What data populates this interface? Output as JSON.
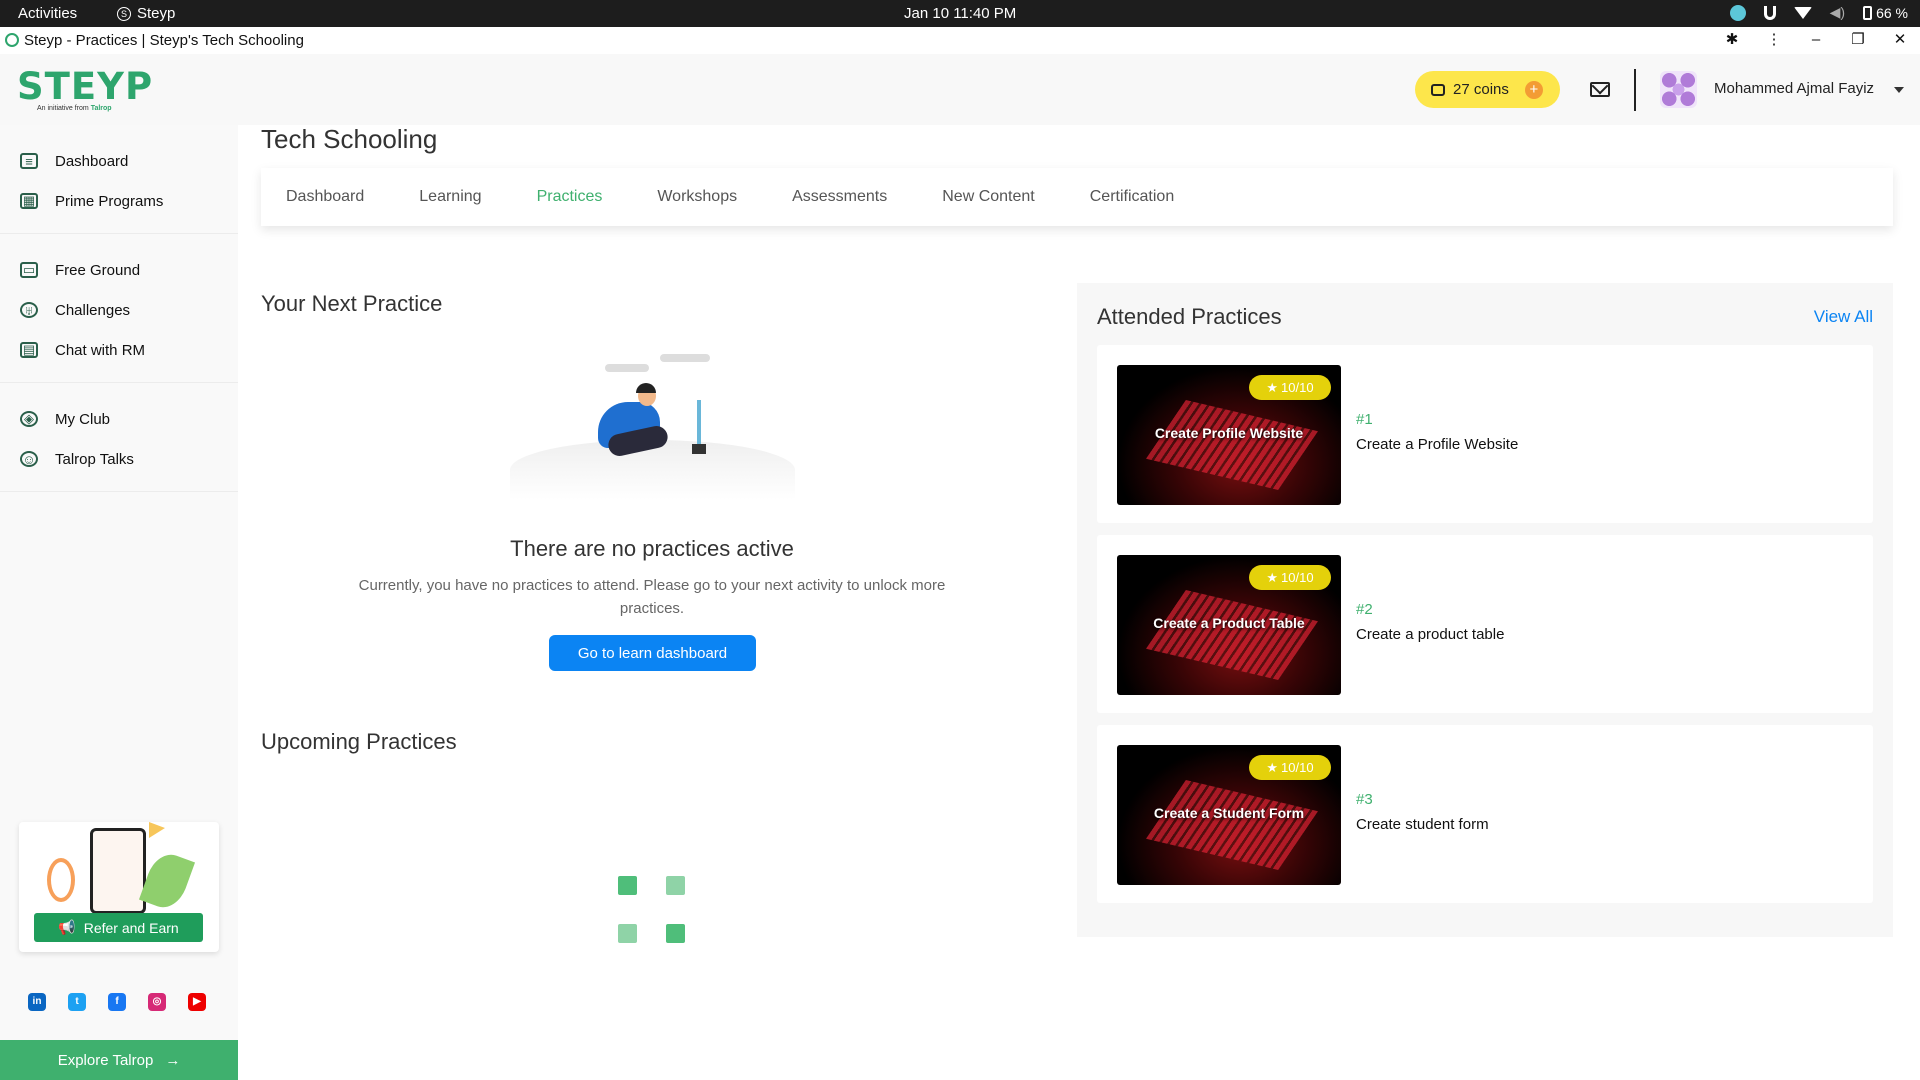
{
  "os": {
    "activities": "Activities",
    "app": "Steyp",
    "clock": "Jan 10  11:40 PM",
    "battery": "66 %"
  },
  "browser": {
    "title": "Steyp - Practices | Steyp's Tech Schooling"
  },
  "header": {
    "logo": "STEYP",
    "tagline_prefix": "An initiative from",
    "tagline_brand": "Talrop",
    "coins": "27 coins",
    "user_name": "Mohammed Ajmal Fayiz"
  },
  "sidebar": {
    "groups": [
      [
        {
          "label": "Dashboard",
          "icon": "dashboard-icon"
        },
        {
          "label": "Prime Programs",
          "icon": "calendar-icon"
        }
      ],
      [
        {
          "label": "Free Ground",
          "icon": "ground-icon"
        },
        {
          "label": "Challenges",
          "icon": "trophy-icon"
        },
        {
          "label": "Chat with RM",
          "icon": "chat-icon"
        }
      ],
      [
        {
          "label": "My Club",
          "icon": "club-icon"
        },
        {
          "label": "Talrop Talks",
          "icon": "talks-icon"
        }
      ]
    ],
    "refer": "Refer and Earn",
    "explore": "Explore Talrop",
    "socials": [
      "linkedin-icon",
      "twitter-icon",
      "facebook-icon",
      "instagram-icon",
      "youtube-icon"
    ]
  },
  "main": {
    "title": "Tech Schooling",
    "tabs": [
      "Dashboard",
      "Learning",
      "Practices",
      "Workshops",
      "Assessments",
      "New Content",
      "Certification"
    ],
    "active_tab": "Practices",
    "next_title": "Your Next Practice",
    "empty_heading": "There are no practices active",
    "empty_text": "Currently, you have no practices to attend. Please go to your next activity to unlock more practices.",
    "learn_button": "Go to learn dashboard",
    "upcoming_title": "Upcoming Practices"
  },
  "attended": {
    "title": "Attended Practices",
    "view_all": "View All",
    "items": [
      {
        "rating": "10/10",
        "thumb_label": "Create Profile Website",
        "number": "#1",
        "name": "Create a Profile Website"
      },
      {
        "rating": "10/10",
        "thumb_label": "Create a Product Table",
        "number": "#2",
        "name": "Create a product table"
      },
      {
        "rating": "10/10",
        "thumb_label": "Create a Student Form",
        "number": "#3",
        "name": "Create student form"
      }
    ]
  },
  "colors": {
    "brand_green": "#2ea56d",
    "active_tab": "#3fb06e",
    "link_blue": "#0b84f3",
    "coins_bg": "#fde64b"
  }
}
